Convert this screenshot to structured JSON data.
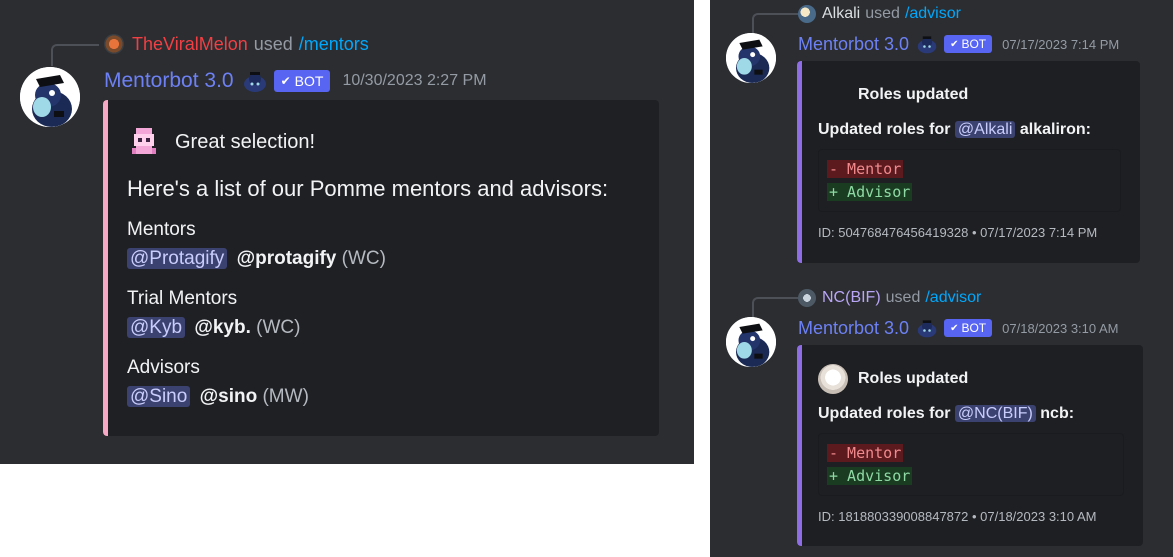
{
  "left": {
    "reply": {
      "user": "TheViralMelon",
      "used": "used",
      "command": "/mentors"
    },
    "bot": {
      "name": "Mentorbot 3.0",
      "tag": "BOT",
      "timestamp": "10/30/2023 2:27 PM"
    },
    "embed": {
      "author": "Great selection!",
      "title": "Here's a list of our Pomme mentors and advisors:",
      "sections": [
        {
          "heading": "Mentors",
          "mention": "@Protagify",
          "username": "@protagify",
          "note": "(WC)"
        },
        {
          "heading": "Trial Mentors",
          "mention": "@Kyb",
          "username": "@kyb.",
          "note": "(WC)"
        },
        {
          "heading": "Advisors",
          "mention": "@Sino",
          "username": "@sino",
          "note": "(MW)"
        }
      ]
    }
  },
  "right": {
    "messages": [
      {
        "reply": {
          "user": "Alkali",
          "used": "used",
          "command": "/advisor"
        },
        "bot": {
          "name": "Mentorbot 3.0",
          "tag": "BOT",
          "timestamp": "07/17/2023 7:14 PM"
        },
        "embed": {
          "author": "Roles updated",
          "desc_prefix": "Updated roles for",
          "mention": "@Alkali",
          "username": "alkaliron:",
          "diff_minus": "- Mentor",
          "diff_plus": "+ Advisor",
          "footer": "ID: 504768476456419328 • 07/17/2023 7:14 PM"
        }
      },
      {
        "reply": {
          "user": "NC(BIF)",
          "used": "used",
          "command": "/advisor"
        },
        "bot": {
          "name": "Mentorbot 3.0",
          "tag": "BOT",
          "timestamp": "07/18/2023 3:10 AM"
        },
        "embed": {
          "author": "Roles updated",
          "desc_prefix": "Updated roles for",
          "mention": "@NC(BIF)",
          "username": "ncb:",
          "diff_minus": "- Mentor",
          "diff_plus": "+ Advisor",
          "footer": "ID: 181880339008847872 • 07/18/2023 3:10 AM"
        }
      }
    ]
  },
  "icons": {
    "bot_tag_check": "✔",
    "avatar": "bot-avatar-icon",
    "bot_emoji": "bot-emoji-icon"
  },
  "colors": {
    "background": "#2b2d31",
    "embed_bg": "#1e1f22",
    "bot_name": "#5865f2",
    "embed_bar_left": "#f7a8c4",
    "embed_bar_right": "#8f6ee5",
    "command": "#00a8fc",
    "reply_user_left": "#f23f43"
  }
}
